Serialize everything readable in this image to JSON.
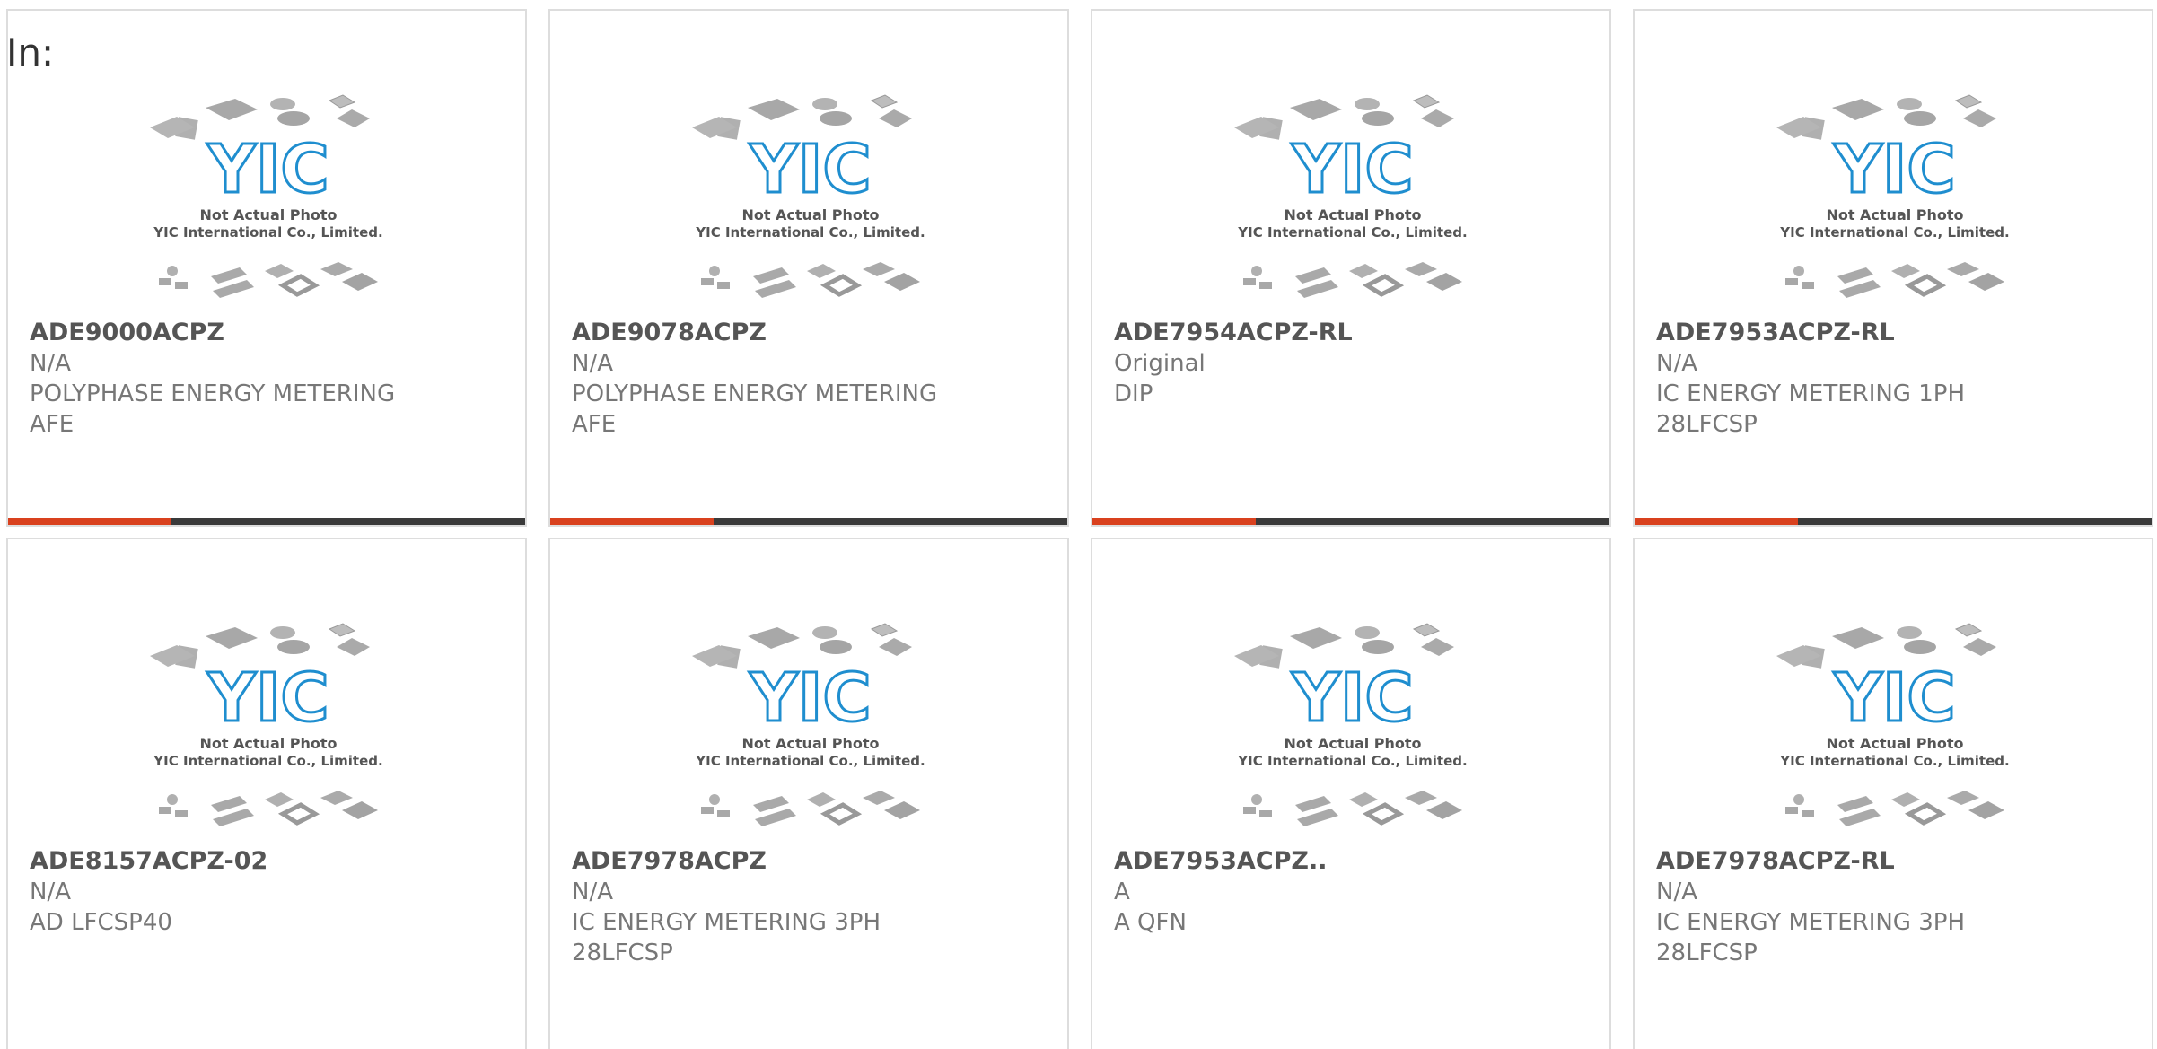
{
  "page": {
    "label": "In:"
  },
  "thumbnail": {
    "logo_text": "YIC",
    "caption_line1": "Not Actual Photo",
    "caption_line2": "YIC International Co., Limited."
  },
  "colors": {
    "accent": "#d9411e",
    "bar": "#3a3a3a",
    "logo": "#1f8ecf",
    "chip": "#a9a9a9"
  },
  "products": [
    {
      "part_number": "ADE9000ACPZ",
      "condition": "N/A",
      "description": "POLYPHASE ENERGY METERING AFE"
    },
    {
      "part_number": "ADE9078ACPZ",
      "condition": "N/A",
      "description": "POLYPHASE ENERGY METERING AFE"
    },
    {
      "part_number": "ADE7954ACPZ-RL",
      "condition": "Original",
      "description": "DIP"
    },
    {
      "part_number": "ADE7953ACPZ-RL",
      "condition": "N/A",
      "description": "IC ENERGY METERING 1PH 28LFCSP"
    },
    {
      "part_number": "ADE8157ACPZ-02",
      "condition": "N/A",
      "description": "AD LFCSP40"
    },
    {
      "part_number": "ADE7978ACPZ",
      "condition": "N/A",
      "description": "IC ENERGY METERING 3PH 28LFCSP"
    },
    {
      "part_number": "ADE7953ACPZ..",
      "condition": "A",
      "description": "A QFN"
    },
    {
      "part_number": "ADE7978ACPZ-RL",
      "condition": "N/A",
      "description": "IC ENERGY METERING 3PH 28LFCSP"
    }
  ]
}
